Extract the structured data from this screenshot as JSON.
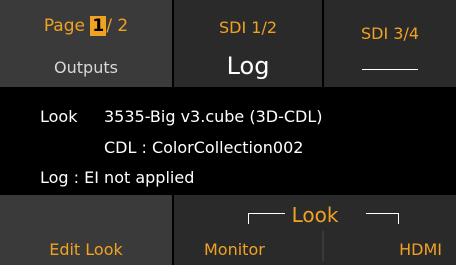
{
  "tabs": {
    "page": {
      "prefix": "Page",
      "current": "1",
      "suffix": "/ 2",
      "sub": "Outputs"
    },
    "sdi12": {
      "label": "SDI 1/2",
      "value": "Log"
    },
    "sdi34": {
      "label": "SDI 3/4",
      "value": "——"
    }
  },
  "info": {
    "look_label": "Look",
    "look_file": "3535-Big v3.cube (3D-CDL)",
    "cdl_line": "CDL : ColorCollection002",
    "log_line": "Log : EI not applied"
  },
  "bottom": {
    "edit_look": "Edit Look",
    "look_title": "Look",
    "monitor": "Monitor",
    "hdmi": "HDMI"
  },
  "colors": {
    "accent": "#f0a223",
    "text": "#ffffff",
    "tab_bg": "#2a2a2a",
    "active_bg": "#3a3a3a"
  }
}
